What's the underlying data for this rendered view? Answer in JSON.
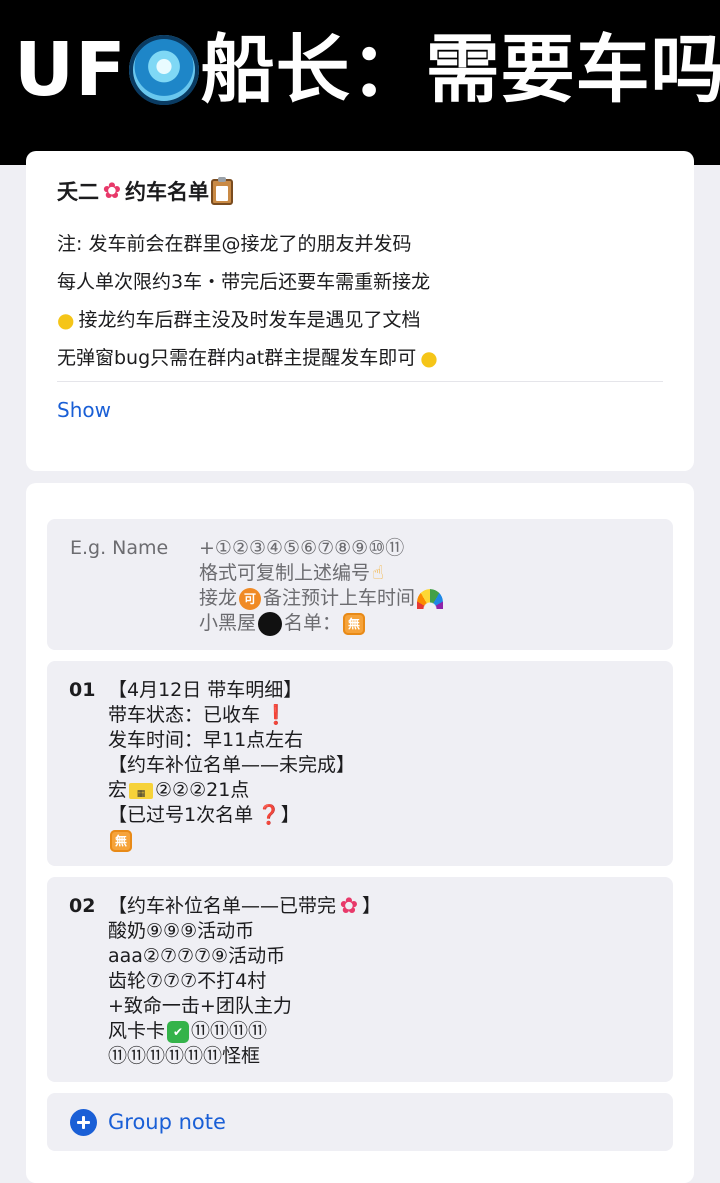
{
  "banner": {
    "title_prefix": "UF",
    "title_suffix": "船长：需要车吗",
    "orb_icon": "ufo-orb-icon"
  },
  "info_card": {
    "title": "夭二",
    "title_rest": "约车名单",
    "lines": [
      "注: 发车前会在群里@接龙了的朋友并发码",
      "每人单次限约3车・带完后还要车需重新接龙",
      "接龙约车后群主没及时发车是遇见了文档",
      "无弹窗bug只需在群内at群主提醒发车即可"
    ],
    "show_label": "Show"
  },
  "example": {
    "label": "E.g.   Name",
    "lines": [
      "+①②③④⑤⑥⑦⑧⑨⑩⑪",
      "格式可复制上述编号",
      [
        "接龙",
        "可",
        "备注预计上车时间"
      ],
      [
        "小黑屋",
        "名单：",
        "無"
      ]
    ]
  },
  "entries": [
    {
      "number": "01",
      "lines": [
        "【4月12日 带车明细】",
        "带车状态：已收车",
        "发车时间：早11点左右",
        "【约车补位名单——未完成】",
        [
          "宏",
          "②②②21点"
        ],
        "【已过号1次名单",
        "】",
        "無"
      ]
    },
    {
      "number": "02",
      "lines": [
        "【约车补位名单——已带完",
        "】",
        "酸奶⑨⑨⑨活动币",
        "aaa②⑦⑦⑦⑨活动币",
        "齿轮⑦⑦⑦不打4村",
        "+致命一击+团队主力",
        [
          "风卡卡",
          "⑪⑪⑪⑪"
        ],
        "⑪⑪⑪⑪⑪⑪怪框"
      ]
    }
  ],
  "group_note": {
    "label": "Group note"
  },
  "colors": {
    "link": "#1a5fd6",
    "background": "#efeff4",
    "banner": "#000000"
  }
}
